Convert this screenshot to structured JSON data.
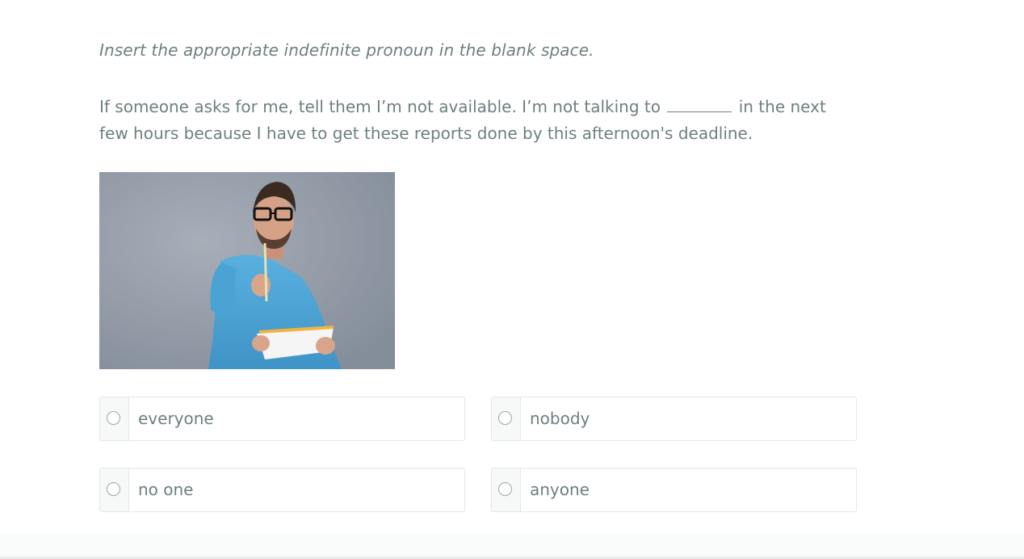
{
  "instruction": "Insert the appropriate indefinite pronoun in the blank space.",
  "question": {
    "before_blank": "If someone asks for me, tell them I’m not available.  I’m not talking to",
    "after_blank": "in the next few hours because I have to get these reports done by this afternoon's deadline."
  },
  "image": {
    "icon": "photo-man-thinking-with-notepad"
  },
  "options": [
    {
      "label": "everyone"
    },
    {
      "label": "nobody"
    },
    {
      "label": "no one"
    },
    {
      "label": "anyone"
    }
  ],
  "colors": {
    "text": "#6d7f80",
    "border": "#e3e7e7",
    "photo_bg": "#8f98a4",
    "shirt": "#4aa3d4"
  }
}
